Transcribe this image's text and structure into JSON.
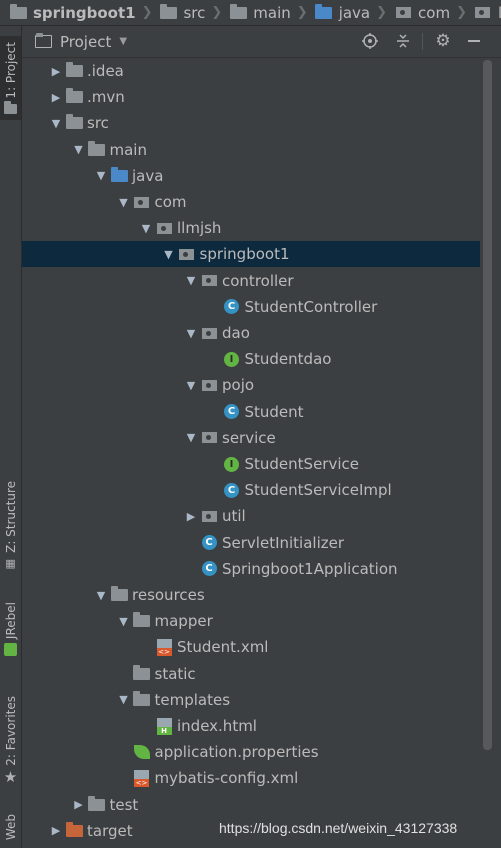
{
  "breadcrumb": [
    "springboot1",
    "src",
    "main",
    "java",
    "com",
    "llmjsh"
  ],
  "left_tabs": {
    "project": "1: Project",
    "structure": "Z: Structure",
    "jrebel": "JRebel",
    "favorites": "2: Favorites",
    "web": "Web"
  },
  "panel": {
    "title": "Project"
  },
  "tree": [
    {
      "label": ".idea",
      "icon": "folder"
    },
    {
      "label": ".mvn",
      "icon": "folder"
    },
    {
      "label": "src",
      "icon": "folder"
    },
    {
      "label": "main",
      "icon": "folder"
    },
    {
      "label": "java",
      "icon": "folder-blue"
    },
    {
      "label": "com",
      "icon": "package"
    },
    {
      "label": "llmjsh",
      "icon": "package"
    },
    {
      "label": "springboot1",
      "icon": "package"
    },
    {
      "label": "controller",
      "icon": "package"
    },
    {
      "label": "StudentController",
      "icon": "class"
    },
    {
      "label": "dao",
      "icon": "package"
    },
    {
      "label": "Studentdao",
      "icon": "interface"
    },
    {
      "label": "pojo",
      "icon": "package"
    },
    {
      "label": "Student",
      "icon": "class"
    },
    {
      "label": "service",
      "icon": "package"
    },
    {
      "label": "StudentService",
      "icon": "interface"
    },
    {
      "label": "StudentServiceImpl",
      "icon": "class"
    },
    {
      "label": "util",
      "icon": "package"
    },
    {
      "label": "ServletInitializer",
      "icon": "class"
    },
    {
      "label": "Springboot1Application",
      "icon": "spring-boot-class"
    },
    {
      "label": "resources",
      "icon": "resources-folder"
    },
    {
      "label": "mapper",
      "icon": "folder"
    },
    {
      "label": "Student.xml",
      "icon": "xml-file"
    },
    {
      "label": "static",
      "icon": "folder"
    },
    {
      "label": "templates",
      "icon": "folder"
    },
    {
      "label": "index.html",
      "icon": "html-file"
    },
    {
      "label": "application.properties",
      "icon": "spring-properties"
    },
    {
      "label": "mybatis-config.xml",
      "icon": "xml-file"
    },
    {
      "label": "test",
      "icon": "folder"
    },
    {
      "label": "target",
      "icon": "folder-orange"
    }
  ],
  "watermark": "https://blog.csdn.net/weixin_43127338",
  "colors": {
    "selection": "#0d293e",
    "background": "#3c3f41",
    "source_folder": "#4a88c7",
    "excluded_folder": "#c7653a"
  }
}
